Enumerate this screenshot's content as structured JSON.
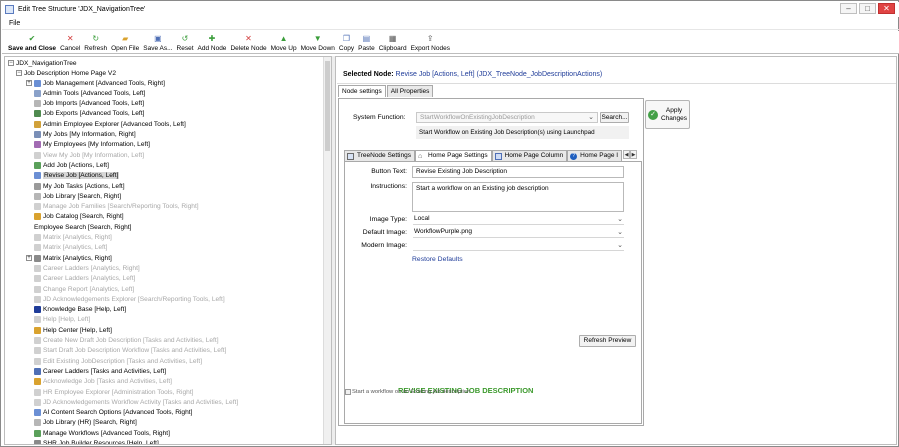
{
  "window": {
    "title": "Edit Tree Structure 'JDX_NavigationTree'"
  },
  "menu": {
    "items": [
      "File"
    ]
  },
  "toolbar": {
    "buttons": [
      {
        "label": "Save and Close",
        "icon": "check-icon",
        "color": "#3a9d3a"
      },
      {
        "label": "Cancel",
        "icon": "close-icon",
        "color": "#d23c3c"
      },
      {
        "label": "Refresh",
        "icon": "refresh-icon",
        "color": "#3a9d3a"
      },
      {
        "label": "Open File",
        "icon": "folder-icon",
        "color": "#d9a22e"
      },
      {
        "label": "Save As...",
        "icon": "save-icon",
        "color": "#4f6fb5"
      },
      {
        "label": "Reset",
        "icon": "reset-icon",
        "color": "#3a9d3a"
      },
      {
        "label": "Add Node",
        "icon": "plus-icon",
        "color": "#3a9d3a"
      },
      {
        "label": "Delete Node",
        "icon": "close-icon",
        "color": "#d23c3c"
      },
      {
        "label": "Move Up",
        "icon": "arrow-up-icon",
        "color": "#3a9d3a"
      },
      {
        "label": "Move Down",
        "icon": "arrow-down-icon",
        "color": "#3a9d3a"
      },
      {
        "label": "Copy",
        "icon": "copy-icon",
        "color": "#4f6fb5"
      },
      {
        "label": "Paste",
        "icon": "paste-icon",
        "color": "#4f6fb5"
      },
      {
        "label": "Clipboard",
        "icon": "clipboard-icon",
        "color": "#555555"
      },
      {
        "label": "Export Nodes",
        "icon": "export-icon",
        "color": "#555555"
      }
    ]
  },
  "tree": {
    "root": "JDX_NavigationTree",
    "page": "Job Description Home Page V2",
    "items": [
      {
        "label": "Job Management [Advanced Tools, Right]",
        "expander": "+",
        "disabled": false,
        "icon": "#6b8fd4"
      },
      {
        "label": "Admin Tools [Advanced Tools, Left]",
        "expander": "",
        "disabled": false,
        "icon": "#8aa1c9"
      },
      {
        "label": "Job Imports [Advanced Tools, Left]",
        "expander": "",
        "disabled": false,
        "icon": "#b6b6b6"
      },
      {
        "label": "Job Exports [Advanced Tools, Left]",
        "expander": "",
        "disabled": false,
        "icon": "#4f8a4f"
      },
      {
        "label": "Admin Employee Explorer [Advanced Tools, Left]",
        "expander": "",
        "disabled": false,
        "icon": "#d1a13a"
      },
      {
        "label": "My Jobs [My Information, Right]",
        "expander": "",
        "disabled": false,
        "icon": "#7a8fb7"
      },
      {
        "label": "My Employees [My Information, Left]",
        "expander": "",
        "disabled": false,
        "icon": "#a26bb3"
      },
      {
        "label": "View My Job [My Information, Left]",
        "expander": "",
        "disabled": true,
        "icon": "#d0d0d0"
      },
      {
        "label": "Add Job [Actions, Left]",
        "expander": "",
        "disabled": false,
        "icon": "#5aa05a"
      },
      {
        "label": "Revise Job [Actions, Left]",
        "expander": "",
        "disabled": false,
        "icon": "#6b8fd4",
        "selected": true
      },
      {
        "label": "My Job Tasks [Actions, Left]",
        "expander": "",
        "disabled": false,
        "icon": "#9a9a9a"
      },
      {
        "label": "Job Library [Search, Right]",
        "expander": "",
        "disabled": false,
        "icon": "#b6b6b6"
      },
      {
        "label": "Manage Job Families [Search/Reporting Tools, Right]",
        "expander": "",
        "disabled": true,
        "icon": "#d0d0d0"
      },
      {
        "label": "Job Catalog [Search, Right]",
        "expander": "",
        "disabled": false,
        "icon": "#d9a22e"
      },
      {
        "label": "Employee Search [Search, Right]",
        "expander": "",
        "disabled": false,
        "icon": ""
      },
      {
        "label": "Matrix [Analytics, Right]",
        "expander": "",
        "disabled": true,
        "icon": "#d0d0d0"
      },
      {
        "label": "Matrix [Analytics, Left]",
        "expander": "",
        "disabled": true,
        "icon": "#d0d0d0"
      },
      {
        "label": "Matrix [Analytics, Right]",
        "expander": "+",
        "disabled": false,
        "icon": "#8a8a8a"
      },
      {
        "label": "Career Ladders [Analytics, Right]",
        "expander": "",
        "disabled": true,
        "icon": "#d0d0d0"
      },
      {
        "label": "Career Ladders [Analytics, Left]",
        "expander": "",
        "disabled": true,
        "icon": "#d0d0d0"
      },
      {
        "label": "Change Report [Analytics, Left]",
        "expander": "",
        "disabled": true,
        "icon": "#d0d0d0"
      },
      {
        "label": "JD Acknowledgements Explorer [Search/Reporting Tools, Left]",
        "expander": "",
        "disabled": true,
        "icon": "#d0d0d0"
      },
      {
        "label": "Knowledge Base [Help, Left]",
        "expander": "",
        "disabled": false,
        "icon": "#1f3c99"
      },
      {
        "label": "Help [Help, Left]",
        "expander": "",
        "disabled": true,
        "icon": "#d0d0d0"
      },
      {
        "label": "Help Center [Help, Left]",
        "expander": "",
        "disabled": false,
        "icon": "#d9a22e"
      },
      {
        "label": "Create New Draft Job Description [Tasks and Activities, Left]",
        "expander": "",
        "disabled": true,
        "icon": "#d0d0d0"
      },
      {
        "label": "Start Draft Job Description Workflow [Tasks and Activities, Left]",
        "expander": "",
        "disabled": true,
        "icon": "#d0d0d0"
      },
      {
        "label": "Edit Existing JobDescription [Tasks and Activities, Left]",
        "expander": "",
        "disabled": true,
        "icon": "#d0d0d0"
      },
      {
        "label": "Career Ladders [Tasks and Activities, Left]",
        "expander": "",
        "disabled": false,
        "icon": "#4f6fb5"
      },
      {
        "label": "Acknowledge Job [Tasks and Activities, Left]",
        "expander": "",
        "disabled": true,
        "icon": "#d9a22e"
      },
      {
        "label": "HR Employee Explorer [Administration Tools, Right]",
        "expander": "",
        "disabled": true,
        "icon": "#d0d0d0"
      },
      {
        "label": "JD Acknowledgements Workflow Activity [Tasks and Activities, Left]",
        "expander": "",
        "disabled": true,
        "icon": "#d0d0d0"
      },
      {
        "label": "AI Content Search Options [Advanced Tools, Right]",
        "expander": "",
        "disabled": false,
        "icon": "#6b8fd4"
      },
      {
        "label": "Job Library (HR) [Search, Right]",
        "expander": "",
        "disabled": false,
        "icon": "#b6b6b6"
      },
      {
        "label": "Manage Workflows [Advanced Tools, Right]",
        "expander": "",
        "disabled": false,
        "icon": "#5aa05a"
      },
      {
        "label": "SHR Job Builder Resources [Help, Left]",
        "expander": "",
        "disabled": false,
        "icon": "#8a8a8a"
      }
    ]
  },
  "details": {
    "selected_label": "Selected Node:",
    "selected_value": "Revise Job [Actions, Left] (JDX_TreeNode_JobDescriptionActions)",
    "tabs": [
      "Node settings",
      "All Properties"
    ],
    "system_function_label": "System Function:",
    "system_function_value": "StartWorkflowOnExistingJobDescription",
    "search_button": "Search...",
    "function_description": "Start Workflow on Existing Job Description(s) using Launchpad",
    "apply_label_1": "Apply",
    "apply_label_2": "Changes",
    "inner_tabs": [
      "TreeNode Settings",
      "Home Page Settings",
      "Home Page Column",
      "Home Page I"
    ],
    "button_text_label": "Button Text:",
    "button_text_value": "Revise Existing Job Description",
    "instructions_label": "Instructions:",
    "instructions_value": "Start a workflow on an Existing job description",
    "image_type_label": "Image Type:",
    "image_type_value": "Local",
    "default_image_label": "Default Image:",
    "default_image_value": "WorkflowPurple.png",
    "modern_image_label": "Modern Image:",
    "modern_image_value": "",
    "restore_defaults": "Restore Defaults",
    "refresh_preview": "Refresh Preview",
    "preview_title": "REVISE EXISTING JOB DESCRIPTION",
    "preview_alt": "Start a workflow on an Existing job description"
  }
}
